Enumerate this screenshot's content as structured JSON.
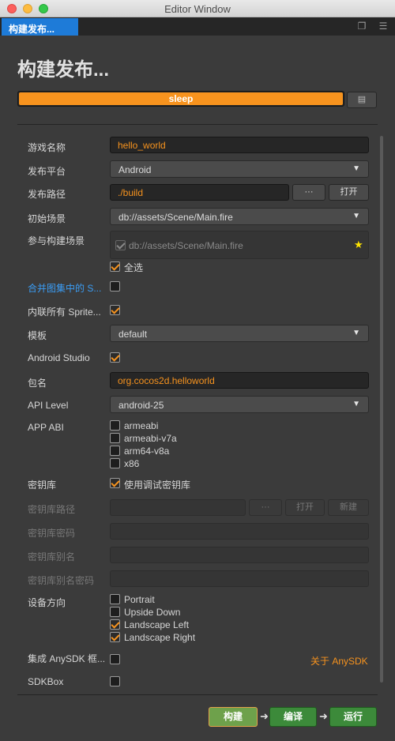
{
  "window": {
    "title": "Editor Window"
  },
  "tab": {
    "label": "构建发布..."
  },
  "heading": "构建发布...",
  "progress": {
    "label": "sleep",
    "fraction": 1.0
  },
  "fields": {
    "game_name": {
      "label": "游戏名称",
      "value": "hello_world"
    },
    "platform": {
      "label": "发布平台",
      "value": "Android"
    },
    "build_path": {
      "label": "发布路径",
      "value": "./build",
      "browse_label": "···",
      "open_label": "打开"
    },
    "start_scene": {
      "label": "初始场景",
      "value": "db://assets/Scene/Main.fire"
    },
    "scenes": {
      "label": "参与构建场景",
      "item": "db://assets/Scene/Main.fire",
      "select_all_label": "全选"
    },
    "merge_atlas": {
      "label": "合并图集中的 S..."
    },
    "inline_sprite": {
      "label": "内联所有 Sprite..."
    },
    "template": {
      "label": "模板",
      "value": "default"
    },
    "android_studio": {
      "label": "Android Studio"
    },
    "package": {
      "label": "包名",
      "value": "org.cocos2d.helloworld"
    },
    "api_level": {
      "label": "API Level",
      "value": "android-25"
    },
    "app_abi": {
      "label": "APP ABI",
      "options": [
        "armeabi",
        "armeabi-v7a",
        "arm64-v8a",
        "x86"
      ]
    },
    "keystore": {
      "label": "密钥库",
      "debug_label": "使用调试密钥库"
    },
    "keystore_path": {
      "label": "密钥库路径",
      "browse_label": "···",
      "open_label": "打开",
      "new_label": "新建"
    },
    "keystore_password": {
      "label": "密钥库密码"
    },
    "keystore_alias": {
      "label": "密钥库别名"
    },
    "alias_password": {
      "label": "密钥库别名密码"
    },
    "orientation": {
      "label": "设备方向",
      "options": [
        "Portrait",
        "Upside Down",
        "Landscape Left",
        "Landscape Right"
      ]
    },
    "anysdk": {
      "label": "集成 AnySDK 框...",
      "link": "关于 AnySDK"
    },
    "sdkbox": {
      "label": "SDKBox"
    }
  },
  "actions": {
    "build": "构建",
    "compile": "编译",
    "run": "运行"
  },
  "colors": {
    "accent": "#f7931e",
    "tab": "#1e7bd8",
    "action_green": "#3c8a3a"
  }
}
